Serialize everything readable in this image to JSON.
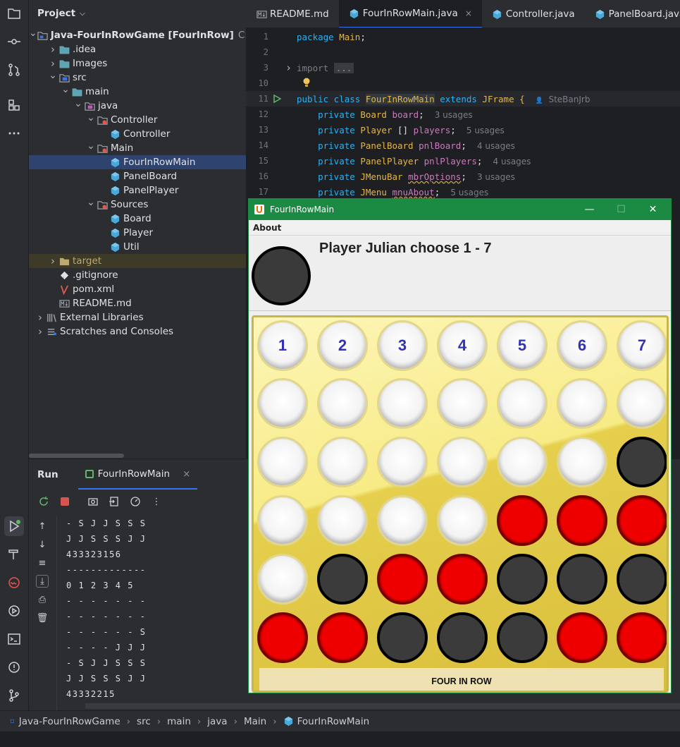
{
  "project": {
    "title": "Project",
    "tree": [
      {
        "label": "Java-FourInRowGame [FourInRow]",
        "extra": "C:\\Use",
        "depth": 0,
        "arrow": "open",
        "icon": "module-folder-icon"
      },
      {
        "label": ".idea",
        "depth": 1,
        "arrow": "closed",
        "icon": "folder-icon"
      },
      {
        "label": "Images",
        "depth": 1,
        "arrow": "closed",
        "icon": "folder-icon"
      },
      {
        "label": "src",
        "depth": 1,
        "arrow": "open",
        "icon": "source-folder-icon"
      },
      {
        "label": "main",
        "depth": 2,
        "arrow": "open",
        "icon": "folder-icon"
      },
      {
        "label": "java",
        "depth": 3,
        "arrow": "open",
        "icon": "source-root-icon"
      },
      {
        "label": "Controller",
        "depth": 4,
        "arrow": "open",
        "icon": "package-icon"
      },
      {
        "label": "Controller",
        "depth": 5,
        "arrow": "none",
        "icon": "class-icon"
      },
      {
        "label": "Main",
        "depth": 4,
        "arrow": "open",
        "icon": "package-icon"
      },
      {
        "label": "FourInRowMain",
        "depth": 5,
        "arrow": "none",
        "icon": "class-icon",
        "selected": true
      },
      {
        "label": "PanelBoard",
        "depth": 5,
        "arrow": "none",
        "icon": "class-icon"
      },
      {
        "label": "PanelPlayer",
        "depth": 5,
        "arrow": "none",
        "icon": "class-icon"
      },
      {
        "label": "Sources",
        "depth": 4,
        "arrow": "open",
        "icon": "package-icon"
      },
      {
        "label": "Board",
        "depth": 5,
        "arrow": "none",
        "icon": "class-icon"
      },
      {
        "label": "Player",
        "depth": 5,
        "arrow": "none",
        "icon": "class-icon"
      },
      {
        "label": "Util",
        "depth": 5,
        "arrow": "none",
        "icon": "class-icon"
      },
      {
        "label": "target",
        "depth": 1,
        "arrow": "closed",
        "icon": "excluded-folder-icon",
        "excluded": true
      },
      {
        "label": ".gitignore",
        "depth": 1,
        "arrow": "none",
        "icon": "gitignore-icon"
      },
      {
        "label": "pom.xml",
        "depth": 1,
        "arrow": "none",
        "icon": "maven-icon"
      },
      {
        "label": "README.md",
        "depth": 1,
        "arrow": "none",
        "icon": "markdown-icon"
      },
      {
        "label": "External Libraries",
        "depth": 0,
        "arrow": "closed",
        "icon": "library-icon"
      },
      {
        "label": "Scratches and Consoles",
        "depth": 0,
        "arrow": "closed",
        "icon": "scratches-icon"
      }
    ]
  },
  "tabs": [
    {
      "label": "README.md",
      "icon": "markdown-icon"
    },
    {
      "label": "FourInRowMain.java",
      "icon": "class-icon",
      "active": true,
      "close": "×"
    },
    {
      "label": "Controller.java",
      "icon": "class-icon"
    },
    {
      "label": "PanelBoard.java",
      "icon": "class-icon"
    }
  ],
  "editor": {
    "lines": [
      {
        "num": "1",
        "html": "<span class='kw'>package</span> <span class='cls'>Main</span>;"
      },
      {
        "num": "2",
        "html": ""
      },
      {
        "num": "3",
        "html": "<span style='color:#7a7e85'>import </span><span class='fold'>...</span>",
        "fold": true
      },
      {
        "num": "10",
        "html": "",
        "bulb": true
      },
      {
        "num": "11",
        "html": "<span class='kw'>public class</span> <span class='cls' style='background:#32393f'>FourInRowMain</span> <span class='kw'>extends</span> <span class='cls'>JFrame</span> <span class='cls'>{</span>",
        "run": true,
        "author": "SteBanJrb"
      },
      {
        "num": "12",
        "html": "    <span class='kw'>private</span> <span class='cls'>Board</span> <span class='fld'>board</span>;",
        "usages": "3 usages"
      },
      {
        "num": "13",
        "html": "    <span class='kw'>private</span> <span class='cls'>Player</span> [] <span class='fld'>players</span>;",
        "usages": "5 usages"
      },
      {
        "num": "14",
        "html": "    <span class='kw'>private</span> <span class='cls'>PanelBoard</span> <span class='fld'>pnlBoard</span>;",
        "usages": "4 usages"
      },
      {
        "num": "15",
        "html": "    <span class='kw'>private</span> <span class='cls'>PanelPlayer</span> <span class='fld'>pnlPlayers</span>;",
        "usages": "4 usages"
      },
      {
        "num": "16",
        "html": "    <span class='kw'>private</span> <span class='cls'>JMenuBar</span> <span class='fld' style='text-decoration:underline wavy #c9a23a'>mbrOptions</span>;",
        "usages": "3 usages"
      },
      {
        "num": "17",
        "html": "    <span class='kw'>private</span> <span class='cls'>JMenu</span> <span class='fld' style='text-decoration:underline wavy #c9a23a'>mnuAbout</span>;",
        "usages": "5 usages"
      }
    ]
  },
  "run": {
    "title": "Run",
    "tab": "FourInRowMain",
    "close": "×",
    "console": [
      "- S J J S S S",
      "J J S S S J J",
      "433323156",
      "-------------",
      "0 1 2 3 4 5",
      "- - - - - - -",
      "- - - - - - -",
      "- - - - - - S",
      "- - - - J J J",
      "- S J J S S S",
      "J J S S S J J",
      "43332215"
    ]
  },
  "status": {
    "breadcrumbs": [
      "Java-FourInRowGame",
      "src",
      "main",
      "java",
      "Main",
      "FourInRowMain"
    ]
  },
  "game": {
    "window_title": "FourInRowMain",
    "menu_about": "About",
    "player_label": "Player Julian choose 1 - 7",
    "current_player_color": "black",
    "footer": "FOUR IN ROW",
    "colors": {
      "titlebar": "#1b8a43",
      "red": "#ee0000",
      "black": "#3b3b3b"
    },
    "grid": [
      [
        "1",
        "2",
        "3",
        "4",
        "5",
        "6",
        "7"
      ],
      [
        "w",
        "w",
        "w",
        "w",
        "w",
        "w",
        "w"
      ],
      [
        "w",
        "w",
        "w",
        "w",
        "w",
        "w",
        "b"
      ],
      [
        "w",
        "w",
        "w",
        "w",
        "r",
        "r",
        "r"
      ],
      [
        "w",
        "b",
        "r",
        "r",
        "b",
        "b",
        "b"
      ],
      [
        "r",
        "r",
        "b",
        "b",
        "b",
        "r",
        "r"
      ]
    ]
  }
}
